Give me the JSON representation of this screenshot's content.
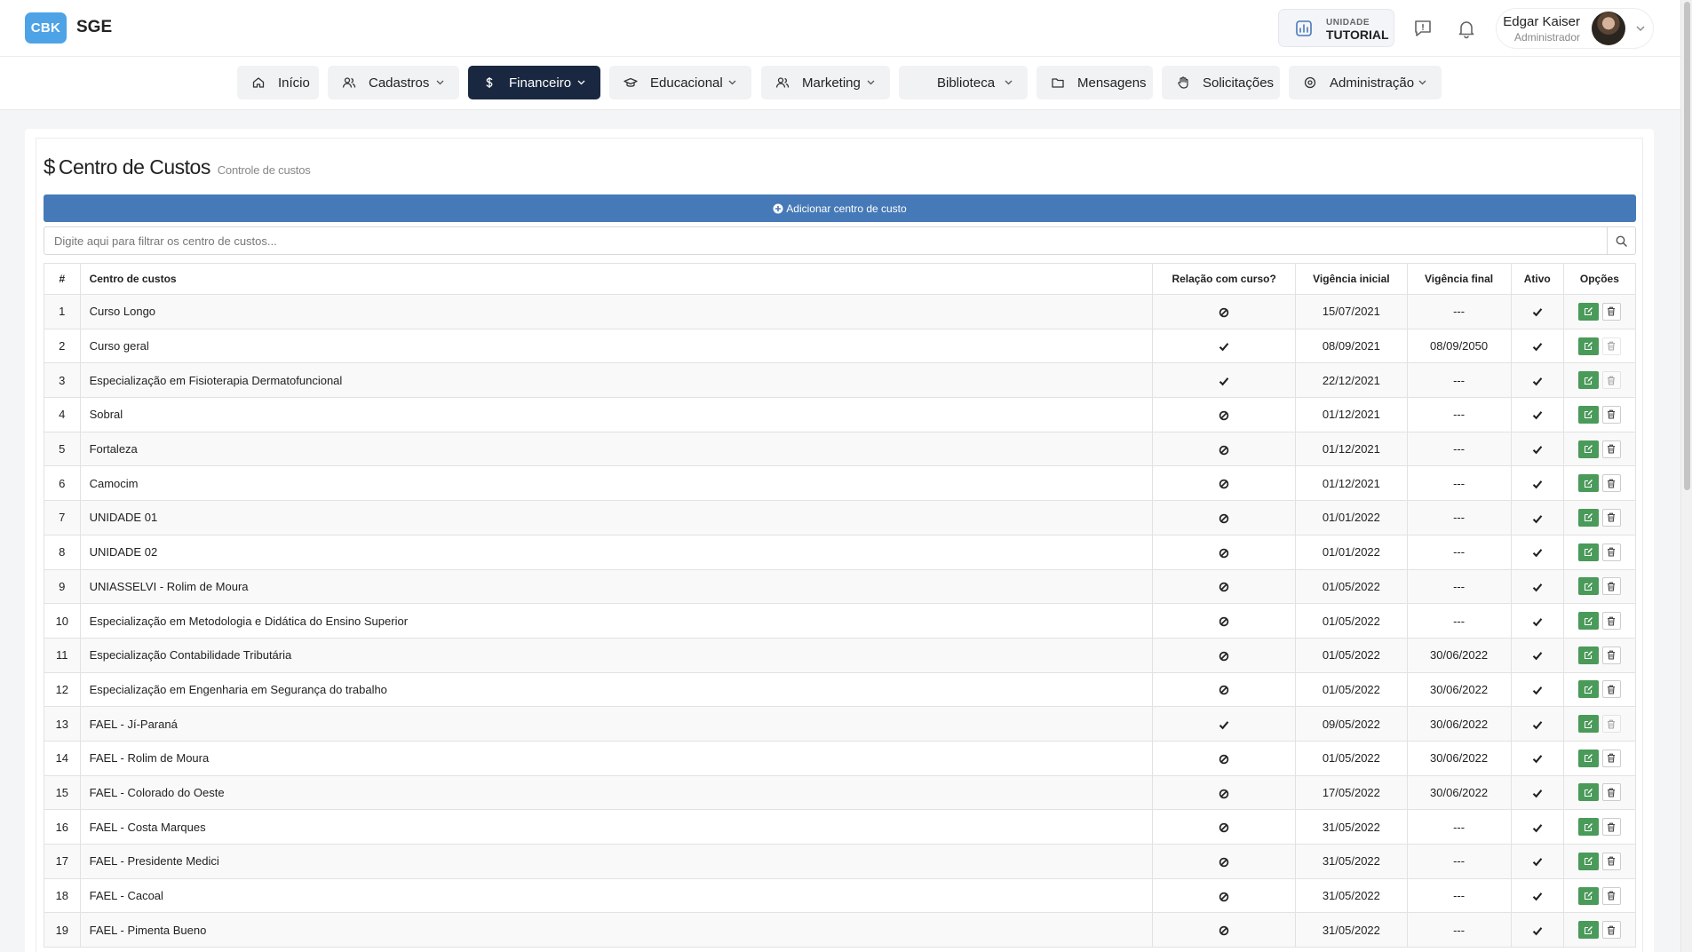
{
  "app": {
    "logo_badge": "CBK",
    "name": "SGE"
  },
  "header": {
    "unit_label": "UNIDADE",
    "unit_name": "TUTORIAL",
    "user_name": "Edgar Kaiser",
    "user_role": "Administrador"
  },
  "nav": [
    {
      "label": "Início",
      "icon": "home-icon",
      "dropdown": false,
      "active": false
    },
    {
      "label": "Cadastros",
      "icon": "users-icon",
      "dropdown": true,
      "active": false
    },
    {
      "label": "Financeiro",
      "icon": "dollar-icon",
      "dropdown": true,
      "active": true
    },
    {
      "label": "Educacional",
      "icon": "graduation-cap-icon",
      "dropdown": true,
      "active": false
    },
    {
      "label": "Marketing",
      "icon": "users-icon",
      "dropdown": true,
      "active": false
    },
    {
      "label": "Biblioteca",
      "icon": "",
      "dropdown": true,
      "active": false
    },
    {
      "label": "Mensagens",
      "icon": "folder-icon",
      "dropdown": false,
      "active": false
    },
    {
      "label": "Solicitações",
      "icon": "hand-icon",
      "dropdown": false,
      "active": false
    },
    {
      "label": "Administração",
      "icon": "gear-icon",
      "dropdown": true,
      "active": false
    }
  ],
  "page": {
    "title": "Centro de Custos",
    "subtitle": "Controle de custos",
    "add_button_label": "Adicionar centro de custo",
    "filter_placeholder": "Digite aqui para filtrar os centro de custos..."
  },
  "table": {
    "headers": {
      "num": "#",
      "name": "Centro de custos",
      "course_relation": "Relação com curso?",
      "start": "Vigência inicial",
      "end": "Vigência final",
      "active": "Ativo",
      "options": "Opções"
    },
    "rows": [
      {
        "num": "1",
        "name": "Curso Longo",
        "course_relation": false,
        "start": "15/07/2021",
        "end": "---",
        "active": true,
        "delete_enabled": true
      },
      {
        "num": "2",
        "name": "Curso geral",
        "course_relation": true,
        "start": "08/09/2021",
        "end": "08/09/2050",
        "active": true,
        "delete_enabled": false
      },
      {
        "num": "3",
        "name": "Especialização em Fisioterapia Dermatofuncional",
        "course_relation": true,
        "start": "22/12/2021",
        "end": "---",
        "active": true,
        "delete_enabled": false
      },
      {
        "num": "4",
        "name": "Sobral",
        "course_relation": false,
        "start": "01/12/2021",
        "end": "---",
        "active": true,
        "delete_enabled": true
      },
      {
        "num": "5",
        "name": "Fortaleza",
        "course_relation": false,
        "start": "01/12/2021",
        "end": "---",
        "active": true,
        "delete_enabled": true
      },
      {
        "num": "6",
        "name": "Camocim",
        "course_relation": false,
        "start": "01/12/2021",
        "end": "---",
        "active": true,
        "delete_enabled": true
      },
      {
        "num": "7",
        "name": "UNIDADE 01",
        "course_relation": false,
        "start": "01/01/2022",
        "end": "---",
        "active": true,
        "delete_enabled": true
      },
      {
        "num": "8",
        "name": "UNIDADE 02",
        "course_relation": false,
        "start": "01/01/2022",
        "end": "---",
        "active": true,
        "delete_enabled": true
      },
      {
        "num": "9",
        "name": "UNIASSELVI - Rolim de Moura",
        "course_relation": false,
        "start": "01/05/2022",
        "end": "---",
        "active": true,
        "delete_enabled": true
      },
      {
        "num": "10",
        "name": "Especialização em Metodologia e Didática do Ensino Superior",
        "course_relation": false,
        "start": "01/05/2022",
        "end": "---",
        "active": true,
        "delete_enabled": true
      },
      {
        "num": "11",
        "name": "Especialização Contabilidade Tributária",
        "course_relation": false,
        "start": "01/05/2022",
        "end": "30/06/2022",
        "active": true,
        "delete_enabled": true
      },
      {
        "num": "12",
        "name": "Especialização em Engenharia em Segurança do trabalho",
        "course_relation": false,
        "start": "01/05/2022",
        "end": "30/06/2022",
        "active": true,
        "delete_enabled": true
      },
      {
        "num": "13",
        "name": "FAEL - Jí-Paraná",
        "course_relation": true,
        "start": "09/05/2022",
        "end": "30/06/2022",
        "active": true,
        "delete_enabled": false
      },
      {
        "num": "14",
        "name": "FAEL - Rolim de Moura",
        "course_relation": false,
        "start": "01/05/2022",
        "end": "30/06/2022",
        "active": true,
        "delete_enabled": true
      },
      {
        "num": "15",
        "name": "FAEL - Colorado do Oeste",
        "course_relation": false,
        "start": "17/05/2022",
        "end": "30/06/2022",
        "active": true,
        "delete_enabled": true
      },
      {
        "num": "16",
        "name": "FAEL - Costa Marques",
        "course_relation": false,
        "start": "31/05/2022",
        "end": "---",
        "active": true,
        "delete_enabled": true
      },
      {
        "num": "17",
        "name": "FAEL - Presidente Medici",
        "course_relation": false,
        "start": "31/05/2022",
        "end": "---",
        "active": true,
        "delete_enabled": true
      },
      {
        "num": "18",
        "name": "FAEL - Cacoal",
        "course_relation": false,
        "start": "31/05/2022",
        "end": "---",
        "active": true,
        "delete_enabled": true
      },
      {
        "num": "19",
        "name": "FAEL - Pimenta Bueno",
        "course_relation": false,
        "start": "31/05/2022",
        "end": "---",
        "active": true,
        "delete_enabled": true
      }
    ]
  },
  "colors": {
    "brand": "#4ea3e6",
    "nav_active": "#1a2740",
    "add_button": "#4679b7",
    "edit_button": "#4a9a5a"
  }
}
